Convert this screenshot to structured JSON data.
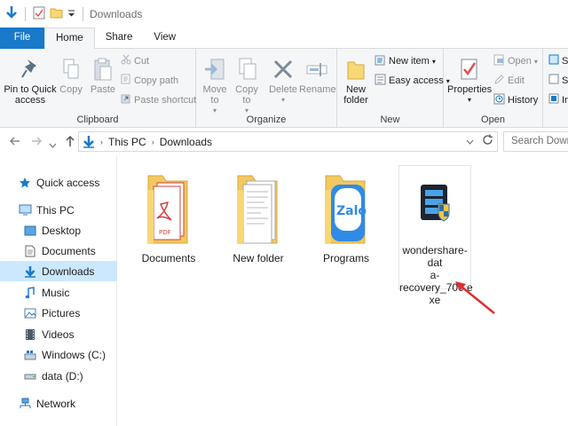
{
  "window": {
    "title": "Downloads"
  },
  "tabs": [
    {
      "label": "File"
    },
    {
      "label": "Home"
    },
    {
      "label": "Share"
    },
    {
      "label": "View"
    }
  ],
  "ribbon": {
    "clipboard": {
      "label": "Clipboard",
      "pin": "Pin to Quick access",
      "copy": "Copy",
      "paste": "Paste",
      "cut": "Cut",
      "copy_path": "Copy path",
      "paste_shortcut": "Paste shortcut"
    },
    "organize": {
      "label": "Organize",
      "move_to": "Move to",
      "copy_to": "Copy to",
      "delete": "Delete",
      "rename": "Rename"
    },
    "new": {
      "label": "New",
      "new_folder": "New folder",
      "new_item": "New item",
      "easy_access": "Easy access"
    },
    "open": {
      "label": "Open",
      "properties": "Properties",
      "open": "Open",
      "edit": "Edit",
      "history": "History"
    },
    "select": {
      "s1": "S",
      "s2": "S",
      "s3": "In"
    }
  },
  "address": {
    "crumbs": [
      "This PC",
      "Downloads"
    ],
    "search_placeholder": "Search Downloads"
  },
  "nav": {
    "items": [
      {
        "label": "Quick access"
      },
      {
        "label": "This PC"
      },
      {
        "label": "Desktop"
      },
      {
        "label": "Documents"
      },
      {
        "label": "Downloads"
      },
      {
        "label": "Music"
      },
      {
        "label": "Pictures"
      },
      {
        "label": "Videos"
      },
      {
        "label": "Windows (C:)"
      },
      {
        "label": "data (D:)"
      },
      {
        "label": "Network"
      }
    ]
  },
  "files": [
    {
      "name": "Documents"
    },
    {
      "name": "New folder"
    },
    {
      "name": "Programs"
    },
    {
      "name": "wondershare-data-recovery_700.exe",
      "line1": "wondershare-dat",
      "line2": "a-recovery_700.e",
      "line3": "xe"
    }
  ],
  "colors": {
    "accent": "#1979ca",
    "selection": "#cce8ff",
    "folder": "#f8d775",
    "arrow": "#e03030"
  }
}
